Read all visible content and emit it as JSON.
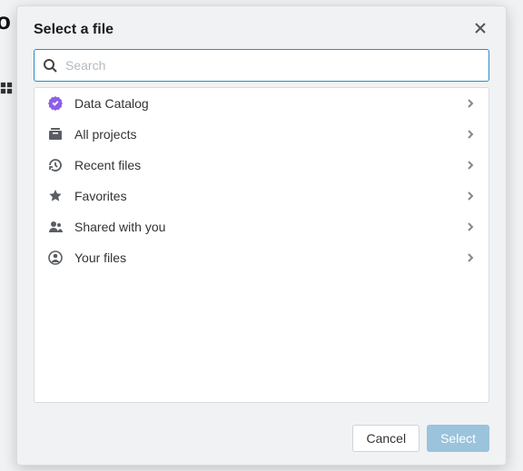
{
  "modal": {
    "title": "Select a file",
    "search_placeholder": "Search",
    "cancel_label": "Cancel",
    "select_label": "Select"
  },
  "items": [
    {
      "label": "Data Catalog",
      "icon": "badge-check",
      "color": "purple"
    },
    {
      "label": "All projects",
      "icon": "projects",
      "color": ""
    },
    {
      "label": "Recent files",
      "icon": "history",
      "color": ""
    },
    {
      "label": "Favorites",
      "icon": "star",
      "color": ""
    },
    {
      "label": "Shared with you",
      "icon": "people",
      "color": ""
    },
    {
      "label": "Your files",
      "icon": "user-circle",
      "color": ""
    }
  ]
}
